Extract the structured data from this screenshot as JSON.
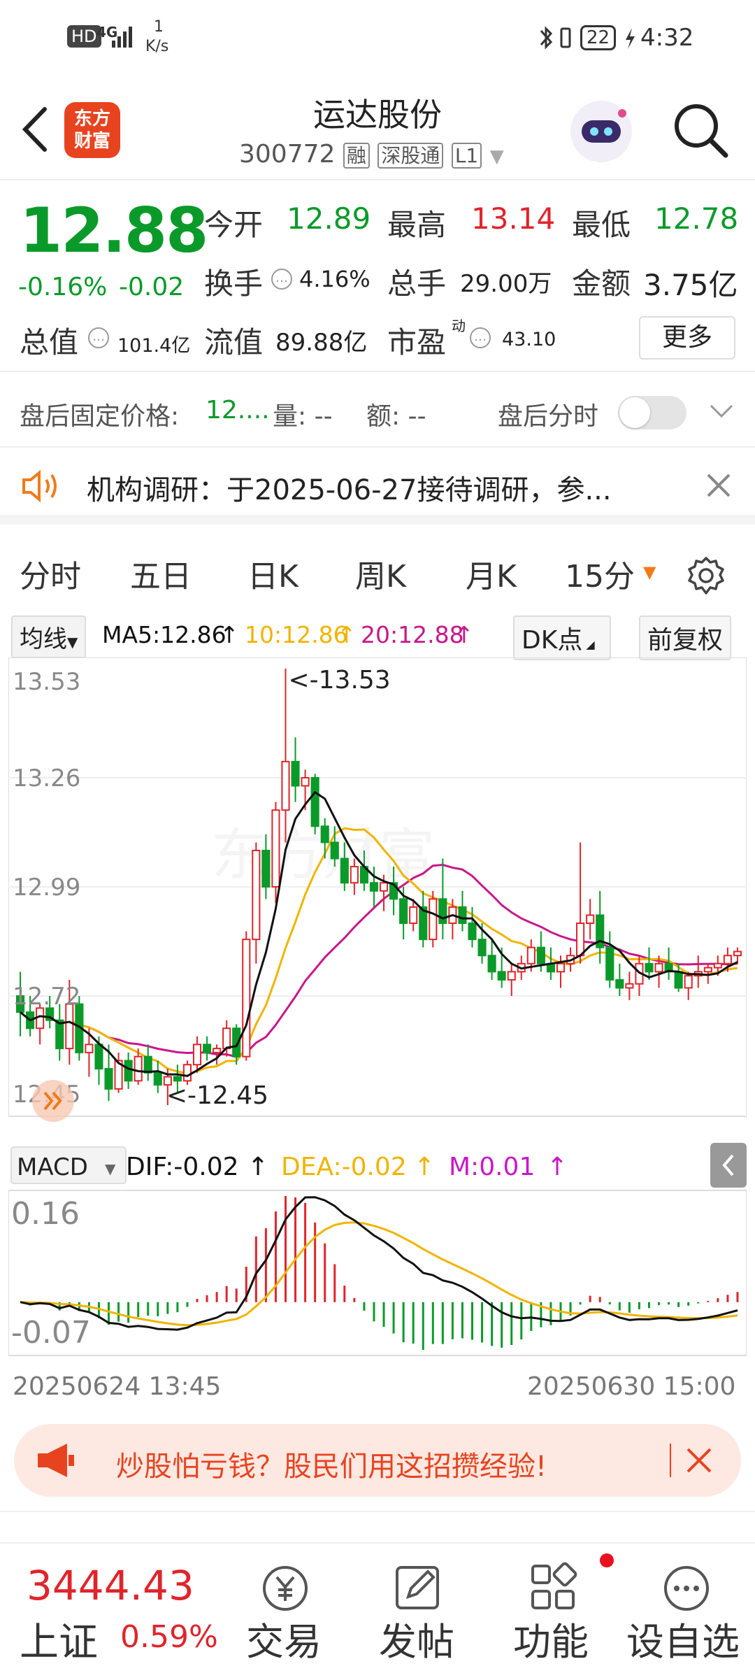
{
  "status_bar": {
    "hd": "HD",
    "network": "4G",
    "speed_value": "1",
    "speed_unit": "K/s",
    "battery": "22",
    "time": "4:32"
  },
  "header": {
    "logo_text_1": "东方",
    "logo_text_2": "财富",
    "title": "运达股份",
    "code": "300772",
    "tags": [
      "融",
      "深股通",
      "L1"
    ]
  },
  "quote": {
    "price": "12.88",
    "change_pct": "-0.16%",
    "change": "-0.02",
    "open_label": "今开",
    "open": "12.89",
    "high_label": "最高",
    "high": "13.14",
    "low_label": "最低",
    "low": "12.78",
    "turnover_label": "换手",
    "turnover": "4.16%",
    "volume_label": "总手",
    "volume": "29.00万",
    "amount_label": "金额",
    "amount": "3.75亿",
    "mcap_label": "总值",
    "mcap": "101.4亿",
    "float_label": "流值",
    "float_val": "89.88亿",
    "pe_label": "市盈",
    "pe_sup": "动",
    "pe": "43.10",
    "more_label": "更多"
  },
  "after_hours": {
    "price_label": "盘后固定价格:",
    "price": "12....",
    "vol_label": "量: --",
    "amt_label": "额: --",
    "toggle_label": "盘后分时",
    "toggle_on": false
  },
  "notice": {
    "text": "机构调研：于2025-06-27接待调研，参..."
  },
  "tabs": [
    {
      "label": "分时",
      "active": false
    },
    {
      "label": "五日",
      "active": false
    },
    {
      "label": "日K",
      "active": false
    },
    {
      "label": "周K",
      "active": false
    },
    {
      "label": "月K",
      "active": false
    },
    {
      "label": "15分",
      "active": true
    }
  ],
  "ma_legend": {
    "selector": "均线",
    "ma5": "MA5:12.86",
    "ma10": "10:12.86",
    "ma20": "20:12.88",
    "dk": "DK点",
    "adjust": "前复权"
  },
  "colors": {
    "up": "#e0242b",
    "down": "#0a9a2a",
    "ma5": "#111111",
    "ma10": "#f0b400",
    "ma20": "#c8188a",
    "accent": "#f07b1a"
  },
  "price_axis": {
    "labels": [
      "13.53",
      "13.26",
      "12.99",
      "12.72",
      "12.45"
    ],
    "max_mark": "<-13.53",
    "min_mark": "<-12.45"
  },
  "macd": {
    "selector": "MACD",
    "dif": "DIF:-0.02",
    "dea": "DEA:-0.02",
    "m": "M:0.01",
    "axis_top": "0.16",
    "axis_bottom": "-0.07"
  },
  "time_axis": {
    "start": "20250624 13:45",
    "end": "20250630 15:00"
  },
  "chart_data": {
    "type": "candlestick",
    "interval": "15min",
    "ylim": [
      12.45,
      13.53
    ],
    "ohlc": [
      [
        12.72,
        12.78,
        12.62,
        12.68
      ],
      [
        12.68,
        12.72,
        12.62,
        12.64
      ],
      [
        12.64,
        12.7,
        12.6,
        12.69
      ],
      [
        12.69,
        12.72,
        12.64,
        12.66
      ],
      [
        12.66,
        12.7,
        12.56,
        12.59
      ],
      [
        12.59,
        12.76,
        12.55,
        12.7
      ],
      [
        12.7,
        12.72,
        12.56,
        12.58
      ],
      [
        12.58,
        12.64,
        12.52,
        12.6
      ],
      [
        12.6,
        12.62,
        12.5,
        12.54
      ],
      [
        12.54,
        12.6,
        12.46,
        12.49
      ],
      [
        12.49,
        12.58,
        12.48,
        12.56
      ],
      [
        12.56,
        12.58,
        12.49,
        12.51
      ],
      [
        12.51,
        12.59,
        12.5,
        12.57
      ],
      [
        12.57,
        12.6,
        12.51,
        12.53
      ],
      [
        12.53,
        12.56,
        12.48,
        12.5
      ],
      [
        12.5,
        12.54,
        12.45,
        12.52
      ],
      [
        12.52,
        12.55,
        12.48,
        12.51
      ],
      [
        12.51,
        12.56,
        12.5,
        12.55
      ],
      [
        12.55,
        12.62,
        12.53,
        12.6
      ],
      [
        12.6,
        12.62,
        12.56,
        12.58
      ],
      [
        12.58,
        12.6,
        12.55,
        12.59
      ],
      [
        12.59,
        12.66,
        12.57,
        12.64
      ],
      [
        12.64,
        12.65,
        12.55,
        12.57
      ],
      [
        12.57,
        12.88,
        12.56,
        12.86
      ],
      [
        12.86,
        13.1,
        12.8,
        13.08
      ],
      [
        13.08,
        13.12,
        12.96,
        12.99
      ],
      [
        12.99,
        13.2,
        12.95,
        13.18
      ],
      [
        13.18,
        13.53,
        13.1,
        13.3
      ],
      [
        13.3,
        13.36,
        13.2,
        13.24
      ],
      [
        13.24,
        13.28,
        13.18,
        13.26
      ],
      [
        13.26,
        13.27,
        13.12,
        13.14
      ],
      [
        13.14,
        13.16,
        13.06,
        13.1
      ],
      [
        13.1,
        13.14,
        13.04,
        13.06
      ],
      [
        13.06,
        13.1,
        12.98,
        13.0
      ],
      [
        13.0,
        13.06,
        12.97,
        13.04
      ],
      [
        13.04,
        13.08,
        12.98,
        13.0
      ],
      [
        13.0,
        13.04,
        12.94,
        12.98
      ],
      [
        12.98,
        13.02,
        12.93,
        13.0
      ],
      [
        13.0,
        13.04,
        12.92,
        12.96
      ],
      [
        12.96,
        12.99,
        12.86,
        12.9
      ],
      [
        12.9,
        12.96,
        12.88,
        12.94
      ],
      [
        12.94,
        12.98,
        12.84,
        12.86
      ],
      [
        12.86,
        12.98,
        12.84,
        12.96
      ],
      [
        12.96,
        13.06,
        12.86,
        12.9
      ],
      [
        12.9,
        12.96,
        12.86,
        12.94
      ],
      [
        12.94,
        12.98,
        12.88,
        12.9
      ],
      [
        12.9,
        12.94,
        12.84,
        12.86
      ],
      [
        12.86,
        12.9,
        12.8,
        12.82
      ],
      [
        12.82,
        12.86,
        12.76,
        12.78
      ],
      [
        12.78,
        12.84,
        12.74,
        12.76
      ],
      [
        12.76,
        12.8,
        12.72,
        12.78
      ],
      [
        12.78,
        12.82,
        12.76,
        12.8
      ],
      [
        12.8,
        12.86,
        12.78,
        12.84
      ],
      [
        12.84,
        12.88,
        12.78,
        12.8
      ],
      [
        12.8,
        12.84,
        12.76,
        12.78
      ],
      [
        12.78,
        12.82,
        12.74,
        12.8
      ],
      [
        12.8,
        12.84,
        12.78,
        12.82
      ],
      [
        12.82,
        13.1,
        12.8,
        12.9
      ],
      [
        12.9,
        12.96,
        12.86,
        12.92
      ],
      [
        12.92,
        12.98,
        12.8,
        12.84
      ],
      [
        12.84,
        12.88,
        12.74,
        12.76
      ],
      [
        12.76,
        12.8,
        12.72,
        12.74
      ],
      [
        12.74,
        12.78,
        12.71,
        12.75
      ],
      [
        12.75,
        12.82,
        12.72,
        12.8
      ],
      [
        12.8,
        12.84,
        12.76,
        12.78
      ],
      [
        12.78,
        12.82,
        12.74,
        12.8
      ],
      [
        12.8,
        12.84,
        12.76,
        12.78
      ],
      [
        12.78,
        12.8,
        12.73,
        12.74
      ],
      [
        12.74,
        12.78,
        12.71,
        12.77
      ],
      [
        12.77,
        12.82,
        12.74,
        12.78
      ],
      [
        12.78,
        12.8,
        12.75,
        12.79
      ],
      [
        12.79,
        12.82,
        12.77,
        12.8
      ],
      [
        12.8,
        12.84,
        12.78,
        12.82
      ],
      [
        12.82,
        12.84,
        12.8,
        12.83
      ]
    ],
    "ma": {
      "ma5": "MA5",
      "ma10": "MA10",
      "ma20": "MA20"
    }
  },
  "ad": {
    "text": "炒股怕亏钱？股民们用这招攒经验!"
  },
  "bottom_nav": {
    "index_value": "3444.43",
    "index_name": "上证",
    "index_change": "0.59%",
    "items": [
      {
        "label": "交易",
        "icon": "yen-circle-icon"
      },
      {
        "label": "发帖",
        "icon": "edit-icon"
      },
      {
        "label": "功能",
        "icon": "grid-icon"
      },
      {
        "label": "设自选",
        "icon": "more-circle-icon"
      }
    ]
  }
}
